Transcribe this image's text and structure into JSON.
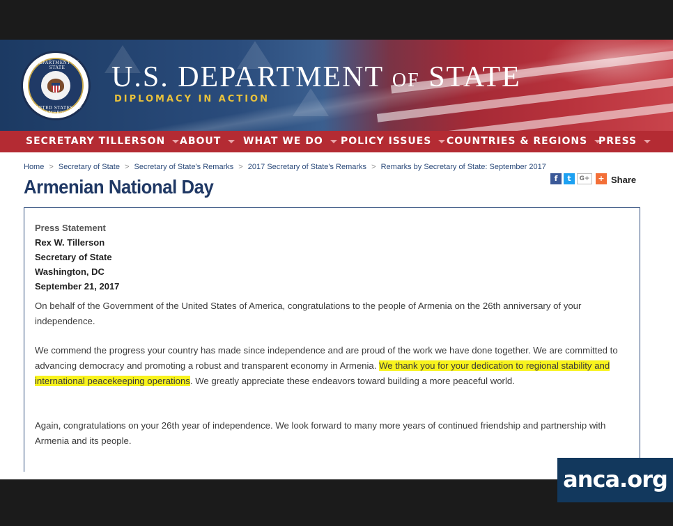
{
  "header": {
    "title_us": "U.S. DEPARTMENT",
    "title_of": "OF",
    "title_state": "STATE",
    "tagline": "DIPLOMACY IN ACTION",
    "seal_top_text": "DEPARTMENT OF STATE",
    "seal_bottom_text": "UNITED STATES OF AMERICA"
  },
  "nav": {
    "items": [
      {
        "label": "SECRETARY TILLERSON"
      },
      {
        "label": "ABOUT"
      },
      {
        "label": "WHAT WE DO"
      },
      {
        "label": "POLICY ISSUES"
      },
      {
        "label": "COUNTRIES & REGIONS"
      },
      {
        "label": "PRESS"
      }
    ]
  },
  "breadcrumb": [
    "Home",
    "Secretary of State",
    "Secretary of State's Remarks",
    "2017 Secretary of State's Remarks",
    "Remarks by Secretary of State: September 2017"
  ],
  "breadcrumb_separator": ">",
  "page_title": "Armenian National Day",
  "share": {
    "label": "Share",
    "icons": {
      "facebook": "f",
      "twitter": "t",
      "google": "G+",
      "plus": "+"
    }
  },
  "statement": {
    "type": "Press Statement",
    "author": "Rex W. Tillerson",
    "position": "Secretary of State",
    "location": "Washington, DC",
    "date": "September 21, 2017"
  },
  "body": {
    "p1": "On behalf of the Government of the United States of America, congratulations to the people of Armenia on the 26th anniversary of your independence.",
    "p2_before": "We commend the progress your country has made since independence and are proud of the work we have done together. We are committed to advancing democracy and promoting a robust and transparent economy in Armenia. ",
    "p2_highlight": "We thank you for your dedication to regional stability and international peacekeeping operations",
    "p2_after": ". We greatly appreciate these endeavors toward building a more peaceful world.",
    "p3": "Again, congratulations on your 26th year of independence. We look forward to many more years of continued friendship and partnership with Armenia and its people."
  },
  "watermark": "anca.org",
  "colors": {
    "nav_red": "#b42b33",
    "title_blue": "#1f3864",
    "highlight": "#f8f31d",
    "tagline_gold": "#e9c23b"
  }
}
